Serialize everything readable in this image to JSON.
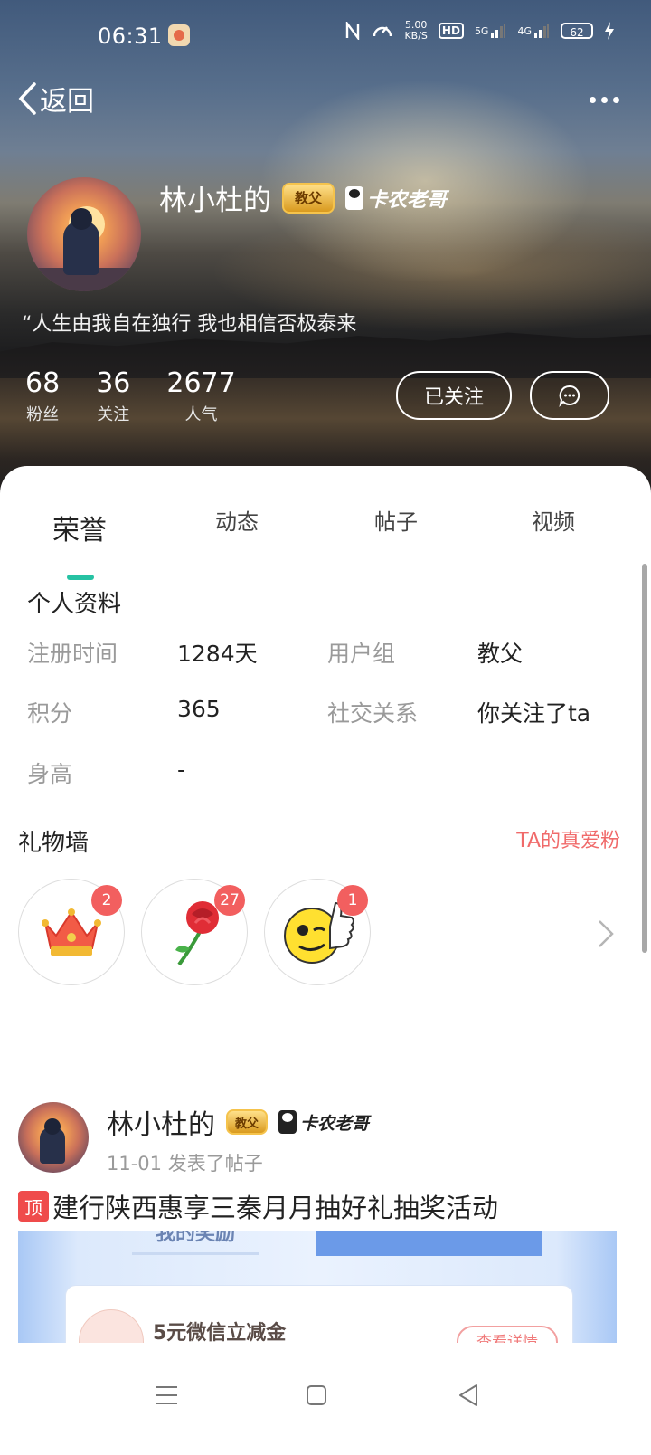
{
  "status": {
    "time": "06:31",
    "net_speed_value": "5.00",
    "net_speed_unit": "KB/S",
    "hd_label": "HD",
    "signal1_label": "5G",
    "signal2_label": "4G",
    "battery": "62"
  },
  "header": {
    "back_label": "返回"
  },
  "profile": {
    "name": "林小杜的",
    "rank_badge": "教父",
    "title_badge": "卡农老哥",
    "signature": "“人生由我自在独行 我也相信否极泰来",
    "stats": [
      {
        "value": "68",
        "label": "粉丝"
      },
      {
        "value": "36",
        "label": "关注"
      },
      {
        "value": "2677",
        "label": "人气"
      }
    ],
    "follow_label": "已关注"
  },
  "tabs": [
    "荣誉",
    "动态",
    "帖子",
    "视频"
  ],
  "info": {
    "title": "个人资料",
    "rows": [
      {
        "label1": "注册时间",
        "value1": "1284天",
        "label2": "用户组",
        "value2": "教父"
      },
      {
        "label1": "积分",
        "value1": "365",
        "label2": "社交关系",
        "value2": "你关注了ta"
      },
      {
        "label1": "身高",
        "value1": "-"
      }
    ]
  },
  "gifts": {
    "title": "礼物墙",
    "link": "TA的真爱粉",
    "items": [
      {
        "icon": "crown-icon",
        "count": "2"
      },
      {
        "icon": "rose-icon",
        "count": "27"
      },
      {
        "icon": "thumbs-up-emoji-icon",
        "count": "1"
      }
    ]
  },
  "post": {
    "author": "林小杜的",
    "rank_badge": "教父",
    "title_badge": "卡农老哥",
    "meta": "11-01 发表了帖子",
    "pin_tag": "顶",
    "title": "建行陕西惠享三秦月月抽好礼抽奖活动",
    "image": {
      "top_left_text": "我的奖励",
      "card_text": "5元微信立减金",
      "card_button": "查看详情"
    }
  },
  "colors": {
    "accent": "#26c2a3",
    "badge_red": "#f25f5f",
    "link_red": "#f06a6a"
  }
}
